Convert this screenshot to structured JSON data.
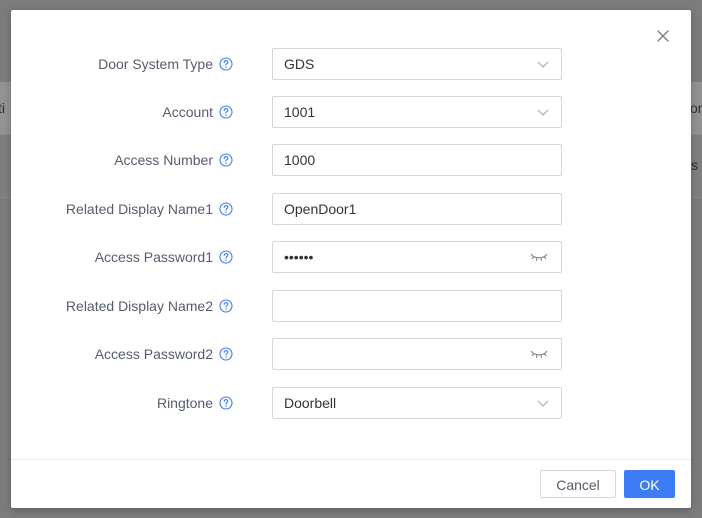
{
  "background": {
    "left_fragment_1": "ti",
    "right_fragment_1": "on",
    "right_fragment_2": "s"
  },
  "dialog": {
    "fields": [
      {
        "label": "Door System Type",
        "type": "select",
        "value": "GDS"
      },
      {
        "label": "Account",
        "type": "select",
        "value": "1001"
      },
      {
        "label": "Access Number",
        "type": "text",
        "value": "1000"
      },
      {
        "label": "Related Display Name1",
        "type": "text",
        "value": "OpenDoor1"
      },
      {
        "label": "Access Password1",
        "type": "password",
        "value": "••••••"
      },
      {
        "label": "Related Display Name2",
        "type": "text",
        "value": ""
      },
      {
        "label": "Access Password2",
        "type": "password",
        "value": ""
      },
      {
        "label": "Ringtone",
        "type": "select",
        "value": "Doorbell"
      }
    ],
    "buttons": {
      "cancel": "Cancel",
      "ok": "OK"
    }
  },
  "colors": {
    "primary": "#3d7cf5",
    "help_icon": "#3d7cf5",
    "label": "#555c6b",
    "border": "#d3d6dc"
  },
  "icons": {
    "close": "close-icon",
    "help": "help-circle-icon",
    "dropdown": "chevron-down-icon",
    "visibility": "eye-closed-icon"
  }
}
